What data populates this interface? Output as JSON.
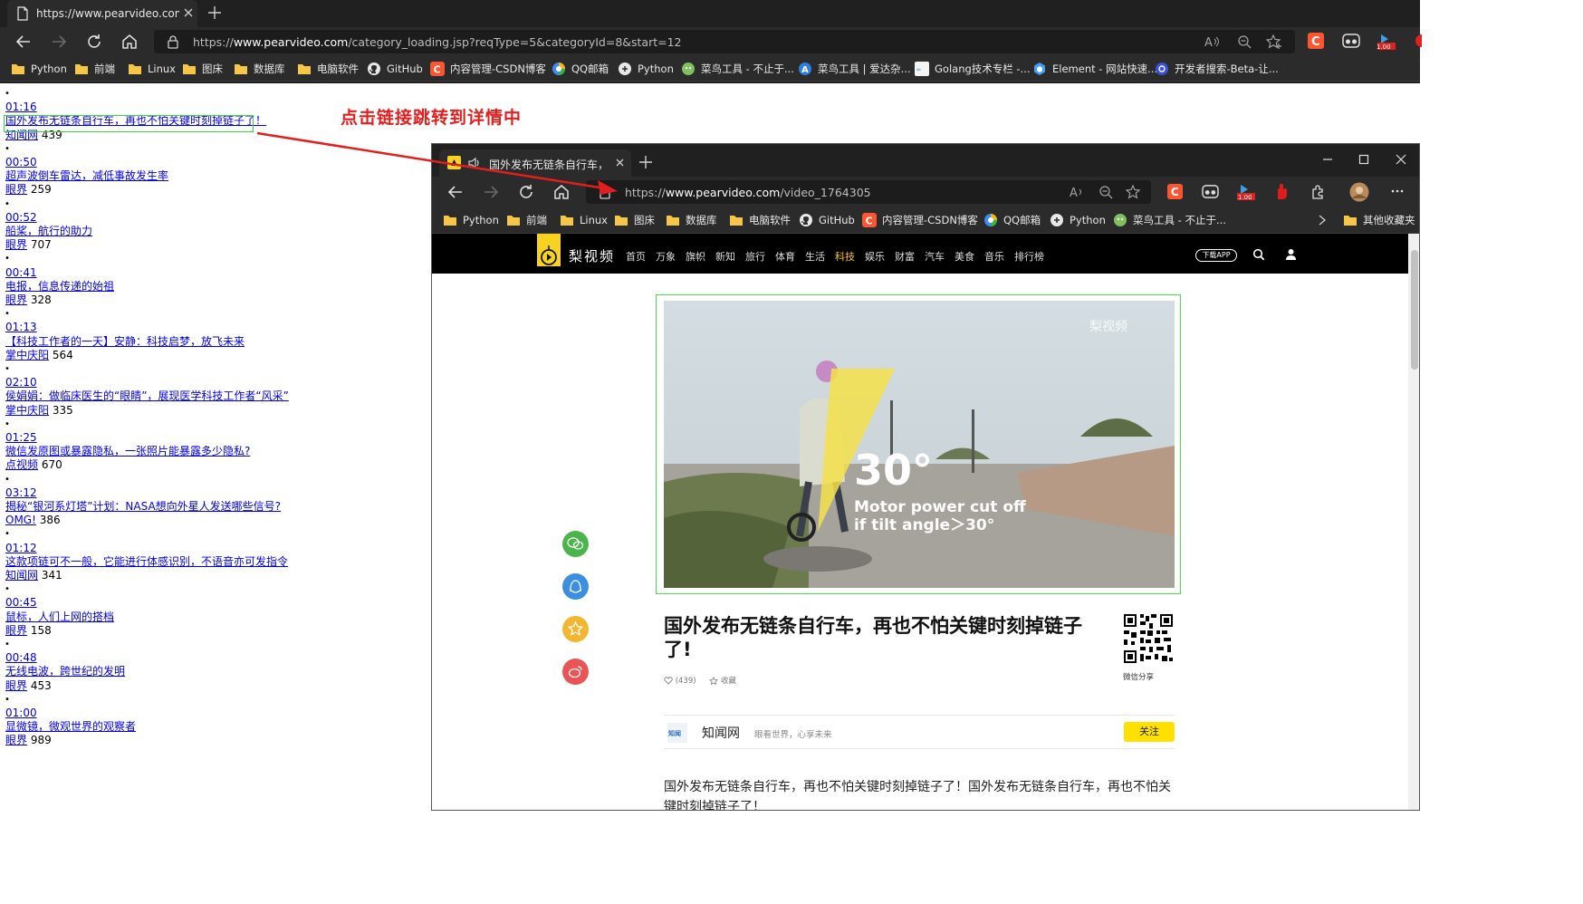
{
  "outer_browser": {
    "tab_title": "https://www.pearvideo.com/category_loading.jsp",
    "url_prefix": "https://",
    "url_domain": "www.pearvideo.com",
    "url_path": "/category_loading.jsp?reqType=5&categoryId=8&start=12",
    "zoom_badge": "1.00",
    "bookmarks": [
      {
        "label": "Python",
        "icon": "folder-icon"
      },
      {
        "label": "前端",
        "icon": "folder-icon"
      },
      {
        "label": "Linux",
        "icon": "folder-icon"
      },
      {
        "label": "图床",
        "icon": "folder-icon"
      },
      {
        "label": "数据库",
        "icon": "folder-icon"
      },
      {
        "label": "电脑软件",
        "icon": "folder-icon"
      },
      {
        "label": "GitHub",
        "icon": "github-icon"
      },
      {
        "label": "内容管理-CSDN博客",
        "icon": "csdn-icon"
      },
      {
        "label": "QQ邮箱",
        "icon": "qqmail-icon"
      },
      {
        "label": "Python",
        "icon": "python-icon"
      },
      {
        "label": "菜鸟工具 - 不止于...",
        "icon": "runoob-icon"
      },
      {
        "label": "菜鸟工具 | 爱达杂...",
        "icon": "a-icon"
      },
      {
        "label": "Golang技术专栏 -...",
        "icon": "golang-icon"
      },
      {
        "label": "Element - 网站快速...",
        "icon": "element-icon"
      },
      {
        "label": "开发者搜索-Beta-让...",
        "icon": "dev-search-icon"
      }
    ]
  },
  "video_list": [
    {
      "time": "01:16",
      "title": "国外发布无链条自行车，再也不怕关键时刻掉链子了！",
      "source": "知闻网",
      "count": "439"
    },
    {
      "time": "00:50",
      "title": "超声波倒车雷达，减低事故发生率",
      "source": "眼界",
      "count": "259"
    },
    {
      "time": "00:52",
      "title": "船桨，航行的助力",
      "source": "眼界",
      "count": "707"
    },
    {
      "time": "00:41",
      "title": "电报，信息传递的始祖",
      "source": "眼界",
      "count": "328"
    },
    {
      "time": "01:13",
      "title": "【科技工作者的一天】安静：科技启梦，放飞未来",
      "source": "掌中庆阳",
      "count": "564"
    },
    {
      "time": "02:10",
      "title": "侯娟娟：做临床医生的“眼睛”，展现医学科技工作者“风采”",
      "source": "掌中庆阳",
      "count": "335"
    },
    {
      "time": "01:25",
      "title": "微信发原图或暴露隐私，一张照片能暴露多少隐私?",
      "source": "点视频",
      "count": "670"
    },
    {
      "time": "03:12",
      "title": "揭秘“银河系灯塔”计划：NASA想向外星人发送哪些信号?",
      "source": "OMG!",
      "count": "386"
    },
    {
      "time": "01:12",
      "title": "这款项链可不一般，它能进行体感识别，不语音亦可发指令",
      "source": "知闻网",
      "count": "341"
    },
    {
      "time": "00:45",
      "title": "鼠标，人们上网的搭档",
      "source": "眼界",
      "count": "158"
    },
    {
      "time": "00:48",
      "title": "无线电波，跨世纪的发明",
      "source": "眼界",
      "count": "453"
    },
    {
      "time": "01:00",
      "title": "显微镜，微观世界的观察者",
      "source": "眼界",
      "count": "989"
    }
  ],
  "annotation": "点击链接跳转到详情中",
  "inner_browser": {
    "tab_title": "国外发布无链条自行车，再",
    "url_prefix": "https://",
    "url_domain": "www.pearvideo.com",
    "url_path": "/video_1764305",
    "zoom_badge": "1.00",
    "bookmarks": [
      {
        "label": "Python",
        "icon": "folder-icon"
      },
      {
        "label": "前端",
        "icon": "folder-icon"
      },
      {
        "label": "Linux",
        "icon": "folder-icon"
      },
      {
        "label": "图床",
        "icon": "folder-icon"
      },
      {
        "label": "数据库",
        "icon": "folder-icon"
      },
      {
        "label": "电脑软件",
        "icon": "folder-icon"
      },
      {
        "label": "GitHub",
        "icon": "github-icon"
      },
      {
        "label": "内容管理-CSDN博客",
        "icon": "csdn-icon"
      },
      {
        "label": "QQ邮箱",
        "icon": "qqmail-icon"
      },
      {
        "label": "Python",
        "icon": "python-icon"
      },
      {
        "label": "菜鸟工具 - 不止于...",
        "icon": "runoob-icon"
      }
    ],
    "other_bookmarks": "其他收藏夹"
  },
  "site": {
    "logo_text": "梨视频",
    "nav": [
      "首页",
      "万象",
      "旗帜",
      "新知",
      "旅行",
      "体育",
      "生活",
      "科技",
      "娱乐",
      "财富",
      "汽车",
      "美食",
      "音乐",
      "排行榜"
    ],
    "active_nav": "科技",
    "download_app": "下载APP",
    "video_overlay_big": "30°",
    "video_overlay_line1": "Motor power cut off",
    "video_overlay_line2": "if tilt angle＞30°",
    "video_watermark": "梨视频",
    "article_title": "国外发布无链条自行车，再也不怕关键时刻掉链子了!",
    "likes": "(439)",
    "collect": "收藏",
    "qr_label": "微信分享",
    "author_name": "知闻网",
    "author_desc": "眼看世界，心享未来",
    "follow": "关注",
    "body_text": "国外发布无链条自行车，再也不怕关键时刻掉链子了！国外发布无链条自行车，再也不怕关键时刻掉链子了！"
  },
  "colors": {
    "accent_yellow": "#f7d21e",
    "link_blue": "#0000ee",
    "annotation_red": "#e31e1e",
    "highlight_green": "#39d53b"
  }
}
